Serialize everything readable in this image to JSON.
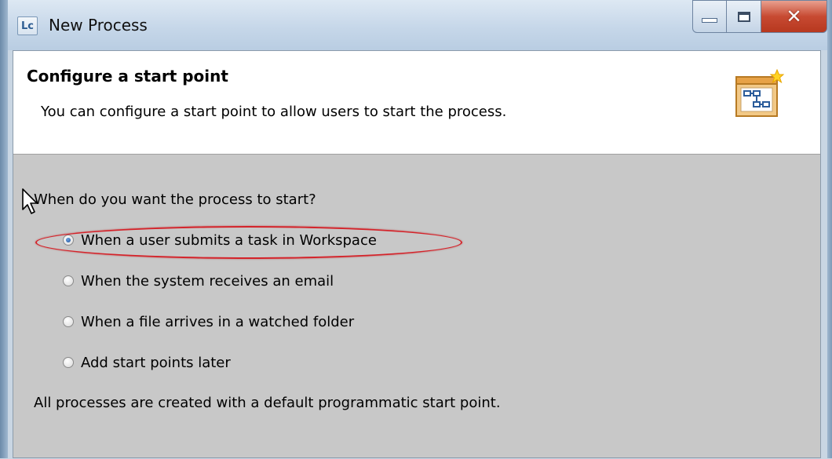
{
  "window": {
    "app_icon_text": "Lc",
    "title": "New Process"
  },
  "header": {
    "title": "Configure a start point",
    "description": "You can configure a start point to allow users to start the process."
  },
  "content": {
    "question": "When do you want the process to start?",
    "options": [
      {
        "label": "When a user submits a task in Workspace",
        "checked": true
      },
      {
        "label": "When the system receives an email",
        "checked": false
      },
      {
        "label": "When a file arrives in a watched folder",
        "checked": false
      },
      {
        "label": "Add start points later",
        "checked": false
      }
    ],
    "note": "All processes are created with a default programmatic start point."
  },
  "icons": {
    "app": "lc-app-icon",
    "wizard": "process-wizard-icon",
    "cursor": "mouse-pointer-icon"
  },
  "colors": {
    "highlight": "#d4232a",
    "dialog_bg": "#c8c8c8",
    "header_bg": "#ffffff"
  }
}
